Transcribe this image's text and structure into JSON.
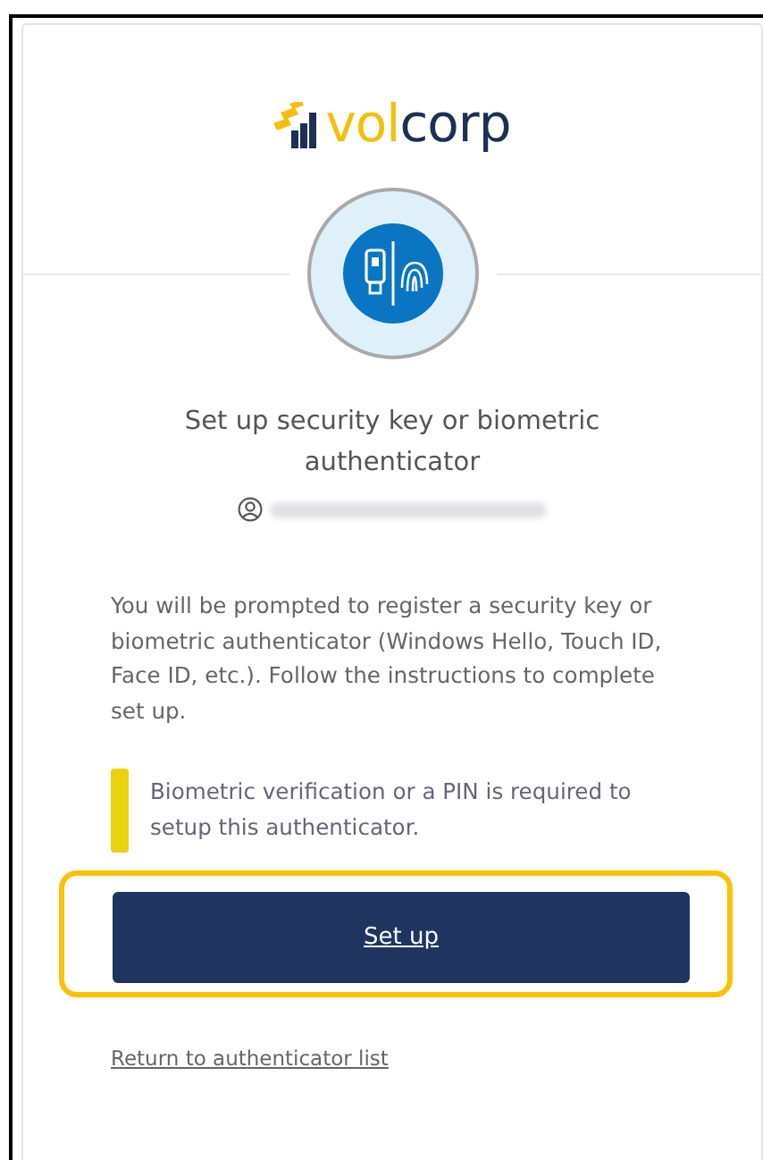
{
  "logo": {
    "wordmark_first": "vol",
    "wordmark_second": "corp"
  },
  "title": "Set up security key or biometric authenticator",
  "account": {
    "redacted": true
  },
  "description": "You will be prompted to register a security key or biometric authenticator (Windows Hello, Touch ID, Face ID, etc.). Follow the instructions to complete set up.",
  "callout": {
    "kind": "warning",
    "text": "Biometric verification or a PIN is required to setup this authenticator."
  },
  "setup_button": {
    "label": "Set up",
    "highlighted": true
  },
  "link": "Return to authenticator list"
}
